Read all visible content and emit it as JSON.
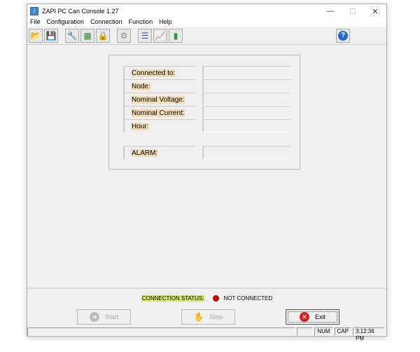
{
  "window": {
    "title": "ZAPI PC Can Console 1.27",
    "minimize": "—",
    "maximize": "☐",
    "close": "✕"
  },
  "menu": [
    "File",
    "Configuration",
    "Connection",
    "Function",
    "Help"
  ],
  "toolbar": [
    {
      "icon": "open-folder-icon",
      "glyph": "📂"
    },
    {
      "icon": "save-icon",
      "glyph": "💾"
    },
    {
      "icon": "tools-icon",
      "glyph": "🔧"
    },
    {
      "icon": "board-icon",
      "glyph": "▦"
    },
    {
      "icon": "lock-icon",
      "glyph": "🔒"
    },
    {
      "icon": "network-icon",
      "glyph": "⚙"
    },
    {
      "icon": "list-icon",
      "glyph": "☰"
    },
    {
      "icon": "chart-icon",
      "glyph": "📈"
    },
    {
      "icon": "book-icon",
      "glyph": "▮"
    }
  ],
  "help_glyph": "?",
  "info": {
    "rows": [
      {
        "label": "Connected to:",
        "value": ""
      },
      {
        "label": "Node:",
        "value": ""
      },
      {
        "label": "Nominal Voltage:",
        "value": ""
      },
      {
        "label": "Nominal Current:",
        "value": ""
      },
      {
        "label": "Hour:",
        "value": ""
      }
    ],
    "alarm": {
      "label": "ALARM:",
      "value": ""
    }
  },
  "status": {
    "label": "CONNECTION STATUS:",
    "value": "NOT CONNECTED",
    "color": "#e00000"
  },
  "buttons": {
    "start": "Start",
    "stop": "Stop",
    "exit": "Exit"
  },
  "statusbar": {
    "num": "NUM",
    "cap": "CAP",
    "time": "3:12:36 PM"
  }
}
